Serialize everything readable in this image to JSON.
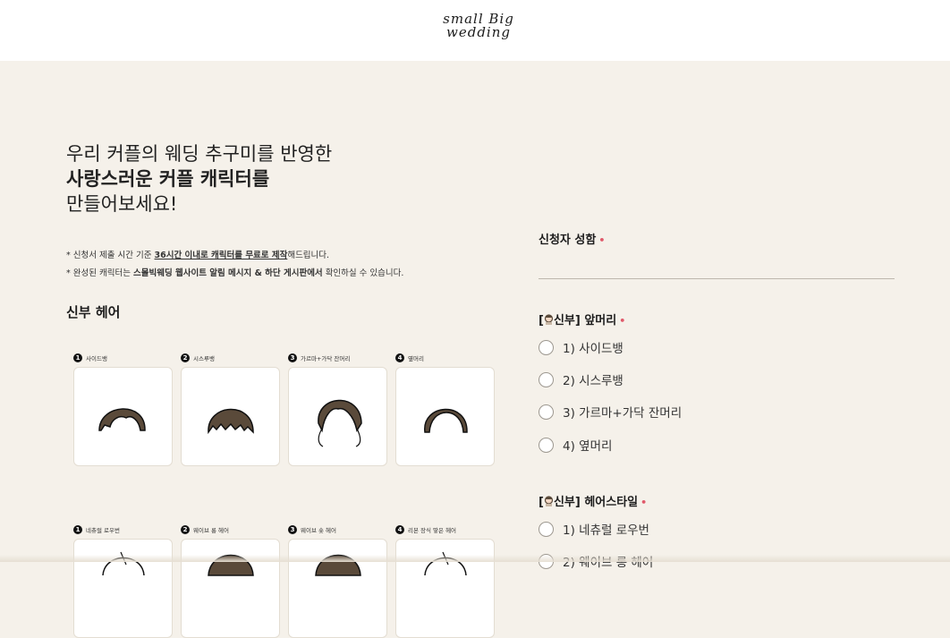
{
  "logo": {
    "line1": "small Big",
    "line2": "wedding"
  },
  "intro": {
    "line1": "우리 커플의 웨딩 추구미를 반영한",
    "line2": "사랑스러운 커플 캐릭터를",
    "line3": "만들어보세요!"
  },
  "notes": {
    "note1_a": "* 신청서 제출 시간 기준 ",
    "note1_b": "36시간 이내로 캐릭터를 무료로 제작",
    "note1_c": "해드립니다.",
    "note2_a": "* 완성된 캐릭터는 ",
    "note2_b": "스몰빅웨딩 웹사이트 알림 메시지 & 하단 게시판에서",
    "note2_c": " 확인하실 수 있습니다."
  },
  "section": {
    "title": "신부 헤어"
  },
  "bangs_cards": [
    {
      "num": "1",
      "label": "사이드뱅"
    },
    {
      "num": "2",
      "label": "시스루뱅"
    },
    {
      "num": "3",
      "label": "가르마+가닥 잔머리"
    },
    {
      "num": "4",
      "label": "옆머리"
    }
  ],
  "style_cards": [
    {
      "num": "1",
      "label": "네츄럴 로우번"
    },
    {
      "num": "2",
      "label": "웨이브 롱 헤어"
    },
    {
      "num": "3",
      "label": "웨이브 숏 헤어"
    },
    {
      "num": "4",
      "label": "리본 장식 땋은 헤어"
    }
  ],
  "form": {
    "name_label": "신청자 성함",
    "required_mark": "•",
    "name_value": "",
    "bangs_label": "신부] 앞머리",
    "bangs_prefix": "[",
    "bangs_options": [
      "1) 사이드뱅",
      "2) 시스루뱅",
      "3) 가르마+가닥 잔머리",
      "4) 옆머리"
    ],
    "style_label": "신부] 헤어스타일",
    "style_prefix": "[",
    "style_options": [
      "1) 네츄럴 로우번",
      "2) 웨이브 롱 헤어"
    ]
  },
  "colors": {
    "background": "#f5f1ea",
    "hair": "#5a4a3a",
    "required": "#e0596a"
  }
}
